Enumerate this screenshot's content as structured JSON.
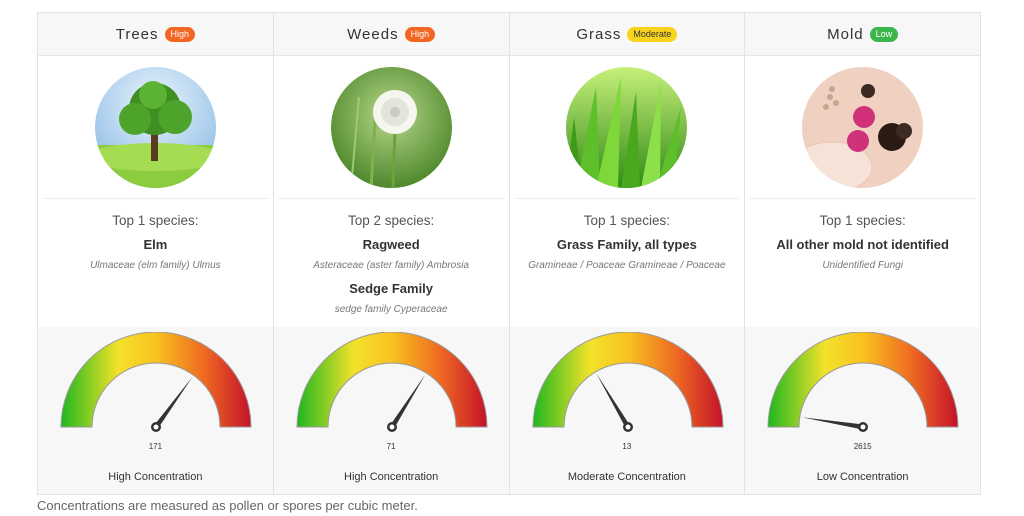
{
  "colors": {
    "high": "#f26522",
    "moderate": "#f7d31e",
    "low": "#3cb54a"
  },
  "columns": [
    {
      "name": "Trees",
      "badge": "High",
      "badge_level": "high",
      "icon": "tree-photo",
      "top_label": "Top 1 species:",
      "species": [
        {
          "name": "Elm",
          "sci": "Ulmaceae (elm family) Ulmus"
        }
      ],
      "value": "171",
      "concentration": "High Concentration",
      "needle_level": 0.7
    },
    {
      "name": "Weeds",
      "badge": "High",
      "badge_level": "high",
      "icon": "dandelion-photo",
      "top_label": "Top 2 species:",
      "species": [
        {
          "name": "Ragweed",
          "sci": "Asteraceae (aster family) Ambrosia"
        },
        {
          "name": "Sedge Family",
          "sci": "sedge family Cyperaceae"
        }
      ],
      "value": "71",
      "concentration": "High Concentration",
      "needle_level": 0.68
    },
    {
      "name": "Grass",
      "badge": "Moderate",
      "badge_level": "moderate",
      "icon": "grass-photo",
      "top_label": "Top 1 species:",
      "species": [
        {
          "name": "Grass Family, all types",
          "sci": "Gramineae / Poaceae Gramineae / Poaceae"
        }
      ],
      "value": "13",
      "concentration": "Moderate Concentration",
      "needle_level": 0.33
    },
    {
      "name": "Mold",
      "badge": "Low",
      "badge_level": "low",
      "icon": "mold-photo",
      "top_label": "Top 1 species:",
      "species": [
        {
          "name": "All other mold not identified",
          "sci": "Unidentified Fungi"
        }
      ],
      "value": "2615",
      "concentration": "Low Concentration",
      "needle_level": 0.05
    }
  ],
  "footnote": "Concentrations are measured as pollen or spores per cubic meter."
}
